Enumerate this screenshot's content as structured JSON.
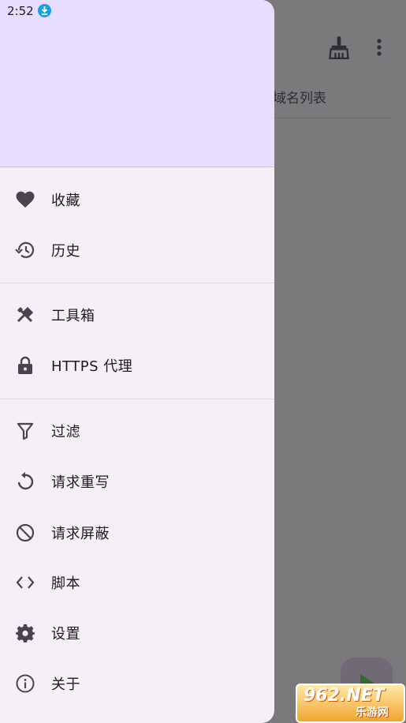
{
  "status_bar": {
    "time": "2:52",
    "download_icon": "download-icon"
  },
  "background": {
    "tab_label": "域名列表",
    "clear_icon": "broom-icon",
    "more_icon": "more-vert-icon",
    "fab_icon": "play-icon"
  },
  "menu": {
    "group1": [
      {
        "label": "收藏",
        "icon": "heart-icon"
      },
      {
        "label": "历史",
        "icon": "history-icon"
      }
    ],
    "group2": [
      {
        "label": "工具箱",
        "icon": "tools-icon"
      },
      {
        "label": "HTTPS 代理",
        "icon": "lock-icon"
      }
    ],
    "group3": [
      {
        "label": "过滤",
        "icon": "filter-icon"
      },
      {
        "label": "请求重写",
        "icon": "replay-icon"
      },
      {
        "label": "请求屏蔽",
        "icon": "block-icon"
      },
      {
        "label": "脚本",
        "icon": "code-icon"
      },
      {
        "label": "设置",
        "icon": "gear-icon"
      },
      {
        "label": "关于",
        "icon": "info-icon"
      }
    ]
  },
  "watermark": {
    "big": "962.NET",
    "small": "乐游网"
  },
  "colors": {
    "header": "#e9ddff",
    "drawer": "#f5f0f7",
    "scrim": "#7a797c"
  }
}
